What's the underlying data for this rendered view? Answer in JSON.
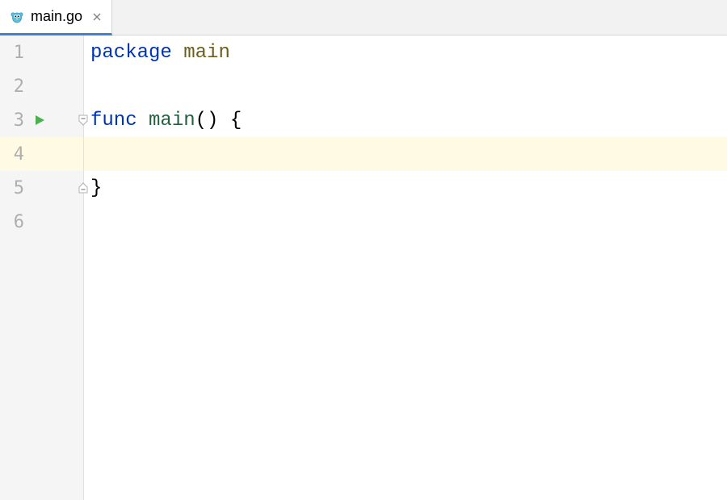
{
  "tab": {
    "label": "main.go",
    "icon_name": "go-gopher-icon"
  },
  "editor": {
    "highlighted_line": 4,
    "lines": [
      {
        "num": "1",
        "run": false,
        "fold": null,
        "tokens": [
          {
            "cls": "kw",
            "t": "package"
          },
          {
            "cls": "pl",
            "t": " "
          },
          {
            "cls": "id",
            "t": "main"
          }
        ]
      },
      {
        "num": "2",
        "run": false,
        "fold": null,
        "tokens": []
      },
      {
        "num": "3",
        "run": true,
        "fold": "open",
        "tokens": [
          {
            "cls": "kw",
            "t": "func"
          },
          {
            "cls": "pl",
            "t": " "
          },
          {
            "cls": "fn",
            "t": "main"
          },
          {
            "cls": "pl",
            "t": "() {"
          }
        ]
      },
      {
        "num": "4",
        "run": false,
        "fold": null,
        "tokens": []
      },
      {
        "num": "5",
        "run": false,
        "fold": "close",
        "tokens": [
          {
            "cls": "pl",
            "t": "}"
          }
        ]
      },
      {
        "num": "6",
        "run": false,
        "fold": null,
        "tokens": []
      }
    ]
  },
  "colors": {
    "tab_underline": "#3b82d4",
    "run_triangle": "#4caf50",
    "highlight_bg": "#fffae3"
  }
}
